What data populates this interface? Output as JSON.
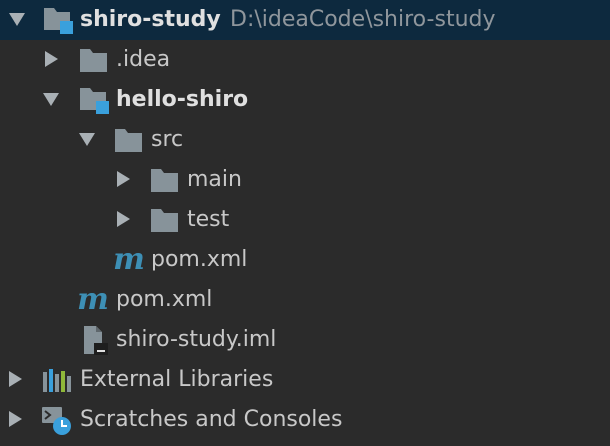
{
  "colors": {
    "background": "#2b2b2b",
    "selected_row": "#0d293e",
    "folder": "#87939a",
    "module_badge": "#3aa0dc",
    "maven": "#3d8fb5",
    "text": "#c8c8c8",
    "path_text": "#8f969c"
  },
  "tree": {
    "root": {
      "label": "shiro-study",
      "path": "D:\\ideaCode\\shiro-study",
      "icon": "module-folder-icon",
      "expanded": true
    },
    "idea": {
      "label": ".idea",
      "icon": "folder-icon",
      "expanded": false
    },
    "hello_shiro": {
      "label": "hello-shiro",
      "icon": "module-folder-icon",
      "expanded": true
    },
    "src": {
      "label": "src",
      "icon": "folder-icon",
      "expanded": true
    },
    "main": {
      "label": "main",
      "icon": "folder-icon",
      "expanded": false
    },
    "test": {
      "label": "test",
      "icon": "folder-icon",
      "expanded": false
    },
    "hello_pom": {
      "label": "pom.xml",
      "icon": "maven-icon"
    },
    "root_pom": {
      "label": "pom.xml",
      "icon": "maven-icon"
    },
    "iml": {
      "label": "shiro-study.iml",
      "icon": "iml-file-icon"
    },
    "external_libraries": {
      "label": "External Libraries",
      "icon": "libraries-icon",
      "expanded": false
    },
    "scratches": {
      "label": "Scratches and Consoles",
      "icon": "scratches-icon",
      "expanded": false
    }
  }
}
